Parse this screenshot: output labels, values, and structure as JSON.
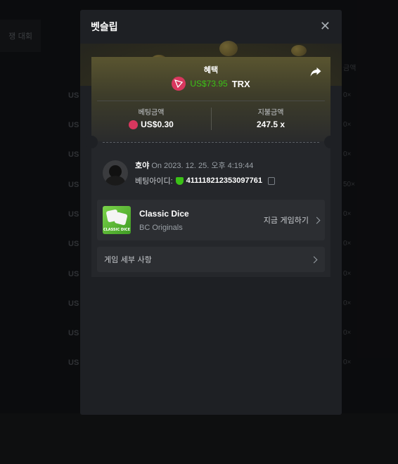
{
  "background": {
    "tab_label": "쟁 대회",
    "header_right": "금액",
    "rows_left": [
      "US",
      "US",
      "US",
      "US",
      "US",
      "US",
      "US",
      "US",
      "US",
      "US"
    ],
    "rows_right": [
      "0×",
      "0×",
      "0×",
      "50×",
      "0×",
      "0×",
      "0×",
      "0×",
      "0×",
      "0×"
    ]
  },
  "modal": {
    "title": "벳슬립",
    "close_icon": "close-icon",
    "reward": {
      "label": "혜택",
      "value": "US$73.95",
      "currency": "TRX",
      "value_color": "#3bc117"
    },
    "bet_amount": {
      "label": "베팅금액",
      "value": "US$0.30"
    },
    "payout": {
      "label": "지불금액",
      "value": "247.5 x"
    },
    "player": {
      "name": "호야",
      "timestamp": "On 2023. 12. 25. 오후 4:19:44",
      "bet_id_label": "베팅아이디:",
      "bet_id": "411118212353097761"
    },
    "game": {
      "title": "Classic Dice",
      "provider": "BC Originals",
      "thumb_label": "CLASSIC DICE",
      "play_label": "지금 게임하기"
    },
    "details_label": "게임 세부 사항",
    "accent_color": "#d9375e"
  }
}
